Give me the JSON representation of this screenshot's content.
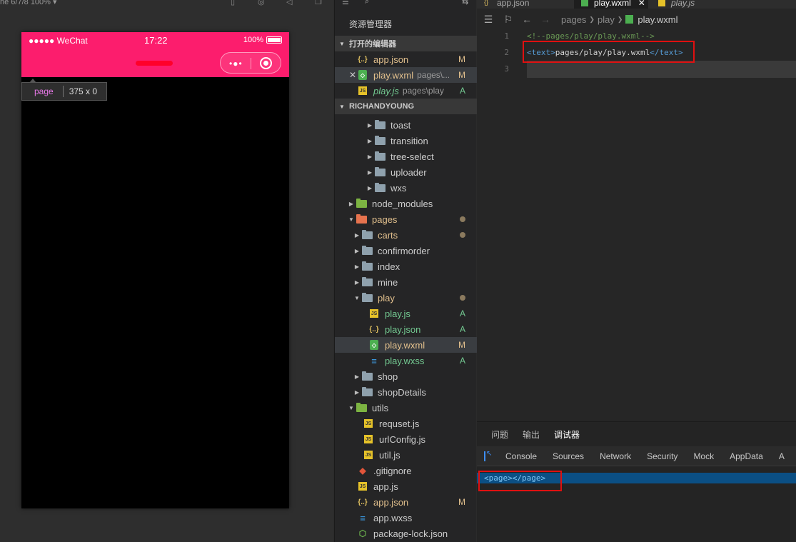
{
  "simulator": {
    "device_info": "ne 6/7/8 100% ▾",
    "status": {
      "carrier": "●●●●● WeChat",
      "time": "17:22",
      "battery": "100%"
    },
    "capsule": {
      "more": "•●•"
    },
    "inspector_tip": {
      "tag": "page",
      "size": "375 x 0"
    },
    "colors": {
      "navbar": "#fc1d6d",
      "page_bg": "#000000"
    }
  },
  "explorer": {
    "title": "资源管理器",
    "open_editors": {
      "header": "打开的编辑器",
      "items": [
        {
          "name": "app.json",
          "icon": "json-icon",
          "badge": "M"
        },
        {
          "name": "play.wxml",
          "path": "pages\\...",
          "icon": "wxml-icon",
          "badge": "M",
          "close": "✕"
        },
        {
          "name": "play.js",
          "path": "pages\\play",
          "icon": "js-icon",
          "badge": "A"
        }
      ]
    },
    "project": {
      "header": "RICHANDYOUNG",
      "items": [
        {
          "name": "toast"
        },
        {
          "name": "transition"
        },
        {
          "name": "tree-select"
        },
        {
          "name": "uploader"
        },
        {
          "name": "wxs"
        },
        {
          "name": "node_modules"
        },
        {
          "name": "pages"
        },
        {
          "name": "carts"
        },
        {
          "name": "confirmorder"
        },
        {
          "name": "index"
        },
        {
          "name": "mine"
        },
        {
          "name": "play"
        },
        {
          "name": "play.js",
          "badge": "A"
        },
        {
          "name": "play.json",
          "badge": "A"
        },
        {
          "name": "play.wxml",
          "badge": "M"
        },
        {
          "name": "play.wxss",
          "badge": "A"
        },
        {
          "name": "shop"
        },
        {
          "name": "shopDetails"
        },
        {
          "name": "utils"
        },
        {
          "name": "requset.js"
        },
        {
          "name": "urlConfig.js"
        },
        {
          "name": "util.js"
        },
        {
          "name": ".gitignore"
        },
        {
          "name": "app.js"
        },
        {
          "name": "app.json",
          "badge": "M"
        },
        {
          "name": "app.wxss"
        },
        {
          "name": "package-lock.json"
        }
      ]
    }
  },
  "editor": {
    "tabs": [
      "app.json",
      "play.wxml",
      "play.js"
    ],
    "tab_close": "✕",
    "breadcrumb": [
      "pages",
      "play",
      "play.wxml"
    ],
    "lines": [
      {
        "num": "1",
        "comment": "<!--pages/play/play.wxml-->"
      },
      {
        "num": "2",
        "open": "<text>",
        "text": "pages/play/play.wxml",
        "close": "</text>"
      },
      {
        "num": "3"
      }
    ]
  },
  "panel": {
    "tabs": [
      "问题",
      "输出",
      "调试器"
    ],
    "devtools_tabs": [
      "Console",
      "Sources",
      "Network",
      "Security",
      "Mock",
      "AppData",
      "A"
    ],
    "dom_line": "<page></page>"
  }
}
